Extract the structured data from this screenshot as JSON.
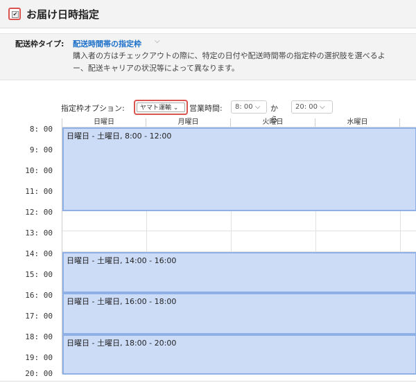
{
  "header": {
    "checkbox_checked": true,
    "check_mark": "✔",
    "title": "お届け日時指定"
  },
  "delivery_type": {
    "label": "配送枠タイプ:",
    "value": "配送時間帯の指定枠",
    "caret": "⌵",
    "description_line1": "購入者の方はチェックアウトの際に、特定の日付や配送時間帯の指定枠の選択肢を選べるよ",
    "description_line2": "ー、配送キャリアの状況等によって異なります。"
  },
  "options": {
    "option_label": "指定枠オプション:",
    "carrier_value": "ヤマト運輸 ⌄",
    "hours_label": "営業時間:",
    "start_time": "8: 00 ⌵",
    "from_label": "から",
    "end_time": "20: 00 ⌵"
  },
  "calendar": {
    "days": [
      "日曜日",
      "月曜日",
      "火曜日",
      "水曜日"
    ],
    "times": [
      "8: 00",
      "9: 00",
      "10: 00",
      "11: 00",
      "12: 00",
      "13: 00",
      "14: 00",
      "15: 00",
      "16: 00",
      "17: 00",
      "18: 00",
      "19: 00",
      "20: 00"
    ],
    "slots": [
      {
        "label": "日曜日 - 土曜日, 8:00 - 12:00"
      },
      {
        "label": "日曜日 - 土曜日, 14:00 - 16:00"
      },
      {
        "label": "日曜日 - 土曜日, 16:00 - 18:00"
      },
      {
        "label": "日曜日 - 土曜日, 18:00 - 20:00"
      }
    ]
  },
  "colors": {
    "accent_red": "#d9534f",
    "link_blue": "#1a6fc9",
    "slot_fill": "#ccdcf7",
    "slot_border": "#8fb0e6"
  }
}
